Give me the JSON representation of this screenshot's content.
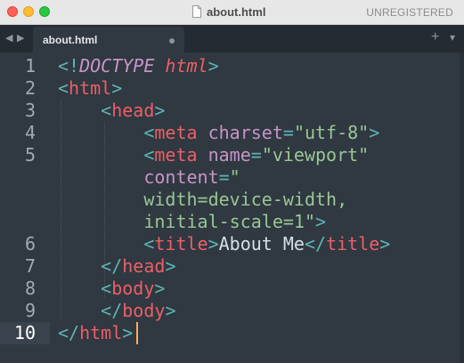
{
  "window": {
    "title": "about.html",
    "status": "UNREGISTERED"
  },
  "tabs": {
    "back_icon": "◀",
    "forward_icon": "▶",
    "items": [
      {
        "label": "about.html",
        "modified": true
      }
    ],
    "new_tab_icon": "+",
    "overflow_icon": "▾"
  },
  "editor": {
    "current_line": 10,
    "lines": [
      {
        "number": "1",
        "tokens": [
          [
            "p",
            "<!"
          ],
          [
            "doc",
            "DOCTYPE "
          ],
          [
            "doc2",
            "html"
          ],
          [
            "p",
            ">"
          ]
        ]
      },
      {
        "number": "2",
        "tokens": [
          [
            "p",
            "<"
          ],
          [
            "t",
            "html"
          ],
          [
            "p",
            ">"
          ]
        ]
      },
      {
        "number": "3",
        "tokens": [
          [
            "d",
            "    "
          ],
          [
            "p",
            "<"
          ],
          [
            "t",
            "head"
          ],
          [
            "p",
            ">"
          ]
        ]
      },
      {
        "number": "4",
        "tokens": [
          [
            "d",
            "        "
          ],
          [
            "p",
            "<"
          ],
          [
            "t",
            "meta"
          ],
          [
            "d",
            " "
          ],
          [
            "a",
            "charset"
          ],
          [
            "p",
            "="
          ],
          [
            "s",
            "\"utf-8\""
          ],
          [
            "p",
            ">"
          ]
        ]
      },
      {
        "number": "5",
        "tokens": [
          [
            "d",
            "        "
          ],
          [
            "p",
            "<"
          ],
          [
            "t",
            "meta"
          ],
          [
            "d",
            " "
          ],
          [
            "a",
            "name"
          ],
          [
            "p",
            "="
          ],
          [
            "s",
            "\"viewport\""
          ]
        ]
      },
      {
        "number": "",
        "tokens": [
          [
            "d",
            "        "
          ],
          [
            "a",
            "content"
          ],
          [
            "p",
            "="
          ],
          [
            "s",
            "\""
          ]
        ]
      },
      {
        "number": "",
        "tokens": [
          [
            "d",
            "        "
          ],
          [
            "s",
            "width=device-width,"
          ]
        ]
      },
      {
        "number": "",
        "tokens": [
          [
            "d",
            "        "
          ],
          [
            "s",
            "initial-scale=1\""
          ],
          [
            "p",
            ">"
          ]
        ]
      },
      {
        "number": "6",
        "tokens": [
          [
            "d",
            "        "
          ],
          [
            "p",
            "<"
          ],
          [
            "t",
            "title"
          ],
          [
            "p",
            ">"
          ],
          [
            "d",
            "About Me"
          ],
          [
            "p",
            "</"
          ],
          [
            "t",
            "title"
          ],
          [
            "p",
            ">"
          ]
        ]
      },
      {
        "number": "7",
        "tokens": [
          [
            "d",
            "    "
          ],
          [
            "p",
            "</"
          ],
          [
            "t",
            "head"
          ],
          [
            "p",
            ">"
          ]
        ]
      },
      {
        "number": "8",
        "tokens": [
          [
            "d",
            "    "
          ],
          [
            "p",
            "<"
          ],
          [
            "t",
            "body"
          ],
          [
            "p",
            ">"
          ]
        ]
      },
      {
        "number": "9",
        "tokens": [
          [
            "d",
            "    "
          ],
          [
            "p",
            "</"
          ],
          [
            "t",
            "body"
          ],
          [
            "p",
            ">"
          ]
        ]
      },
      {
        "number": "10",
        "tokens": [
          [
            "p",
            "</"
          ],
          [
            "t",
            "html"
          ],
          [
            "p",
            ">"
          ]
        ]
      }
    ]
  }
}
